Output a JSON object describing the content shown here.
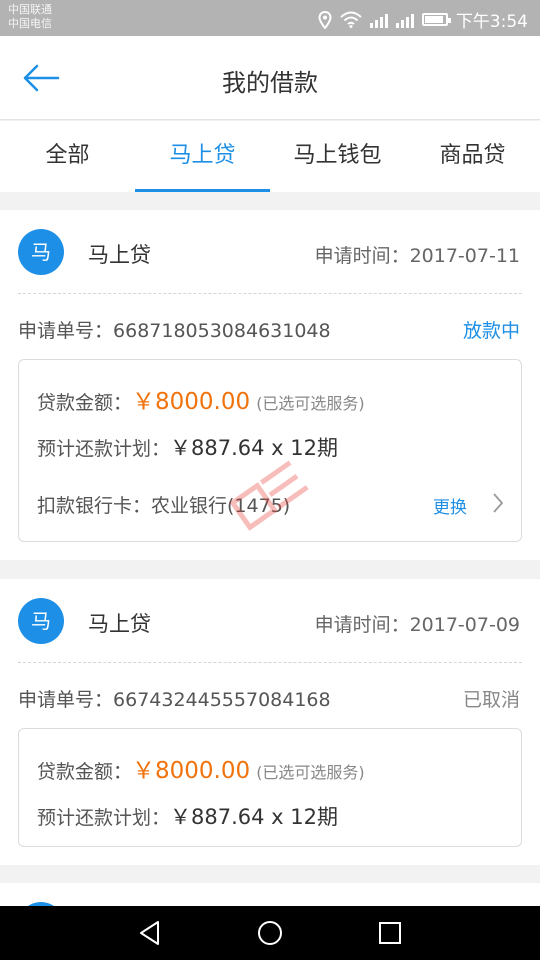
{
  "status_bar": {
    "carrier_1": "中国联通",
    "carrier_2": "中国电信",
    "time": "下午3:54"
  },
  "header": {
    "title": "我的借款",
    "back_icon": "arrow-left-icon"
  },
  "tabs": [
    {
      "label": "全部",
      "active": false
    },
    {
      "label": "马上贷",
      "active": true
    },
    {
      "label": "马上钱包",
      "active": false
    },
    {
      "label": "商品贷",
      "active": false
    }
  ],
  "colors": {
    "accent": "#1d8fe6",
    "amount": "#f0730d",
    "muted": "#888888"
  },
  "loans": [
    {
      "badge": "马",
      "product": "马上贷",
      "apply_time_label": "申请时间：",
      "apply_time": "2017-07-11",
      "order_label": "申请单号：",
      "order_no": "668718053084631048",
      "status": "放款中",
      "amount_label": "贷款金额：",
      "amount": "￥8000.00",
      "amount_note": "(已选可选服务)",
      "plan_label": "预计还款计划：",
      "plan": "￥887.64 x 12期",
      "bank_label": "扣款银行卡：",
      "bank": "农业银行(1475)",
      "change_label": "更换"
    },
    {
      "badge": "马",
      "product": "马上贷",
      "apply_time_label": "申请时间：",
      "apply_time": "2017-07-09",
      "order_label": "申请单号：",
      "order_no": "667432445557084168",
      "status": "已取消",
      "amount_label": "贷款金额：",
      "amount": "￥8000.00",
      "amount_note": "(已选可选服务)",
      "plan_label": "预计还款计划：",
      "plan": "￥887.64 x 12期"
    }
  ],
  "nav": {
    "back": "triangle-back-icon",
    "home": "circle-home-icon",
    "recents": "square-recents-icon"
  }
}
